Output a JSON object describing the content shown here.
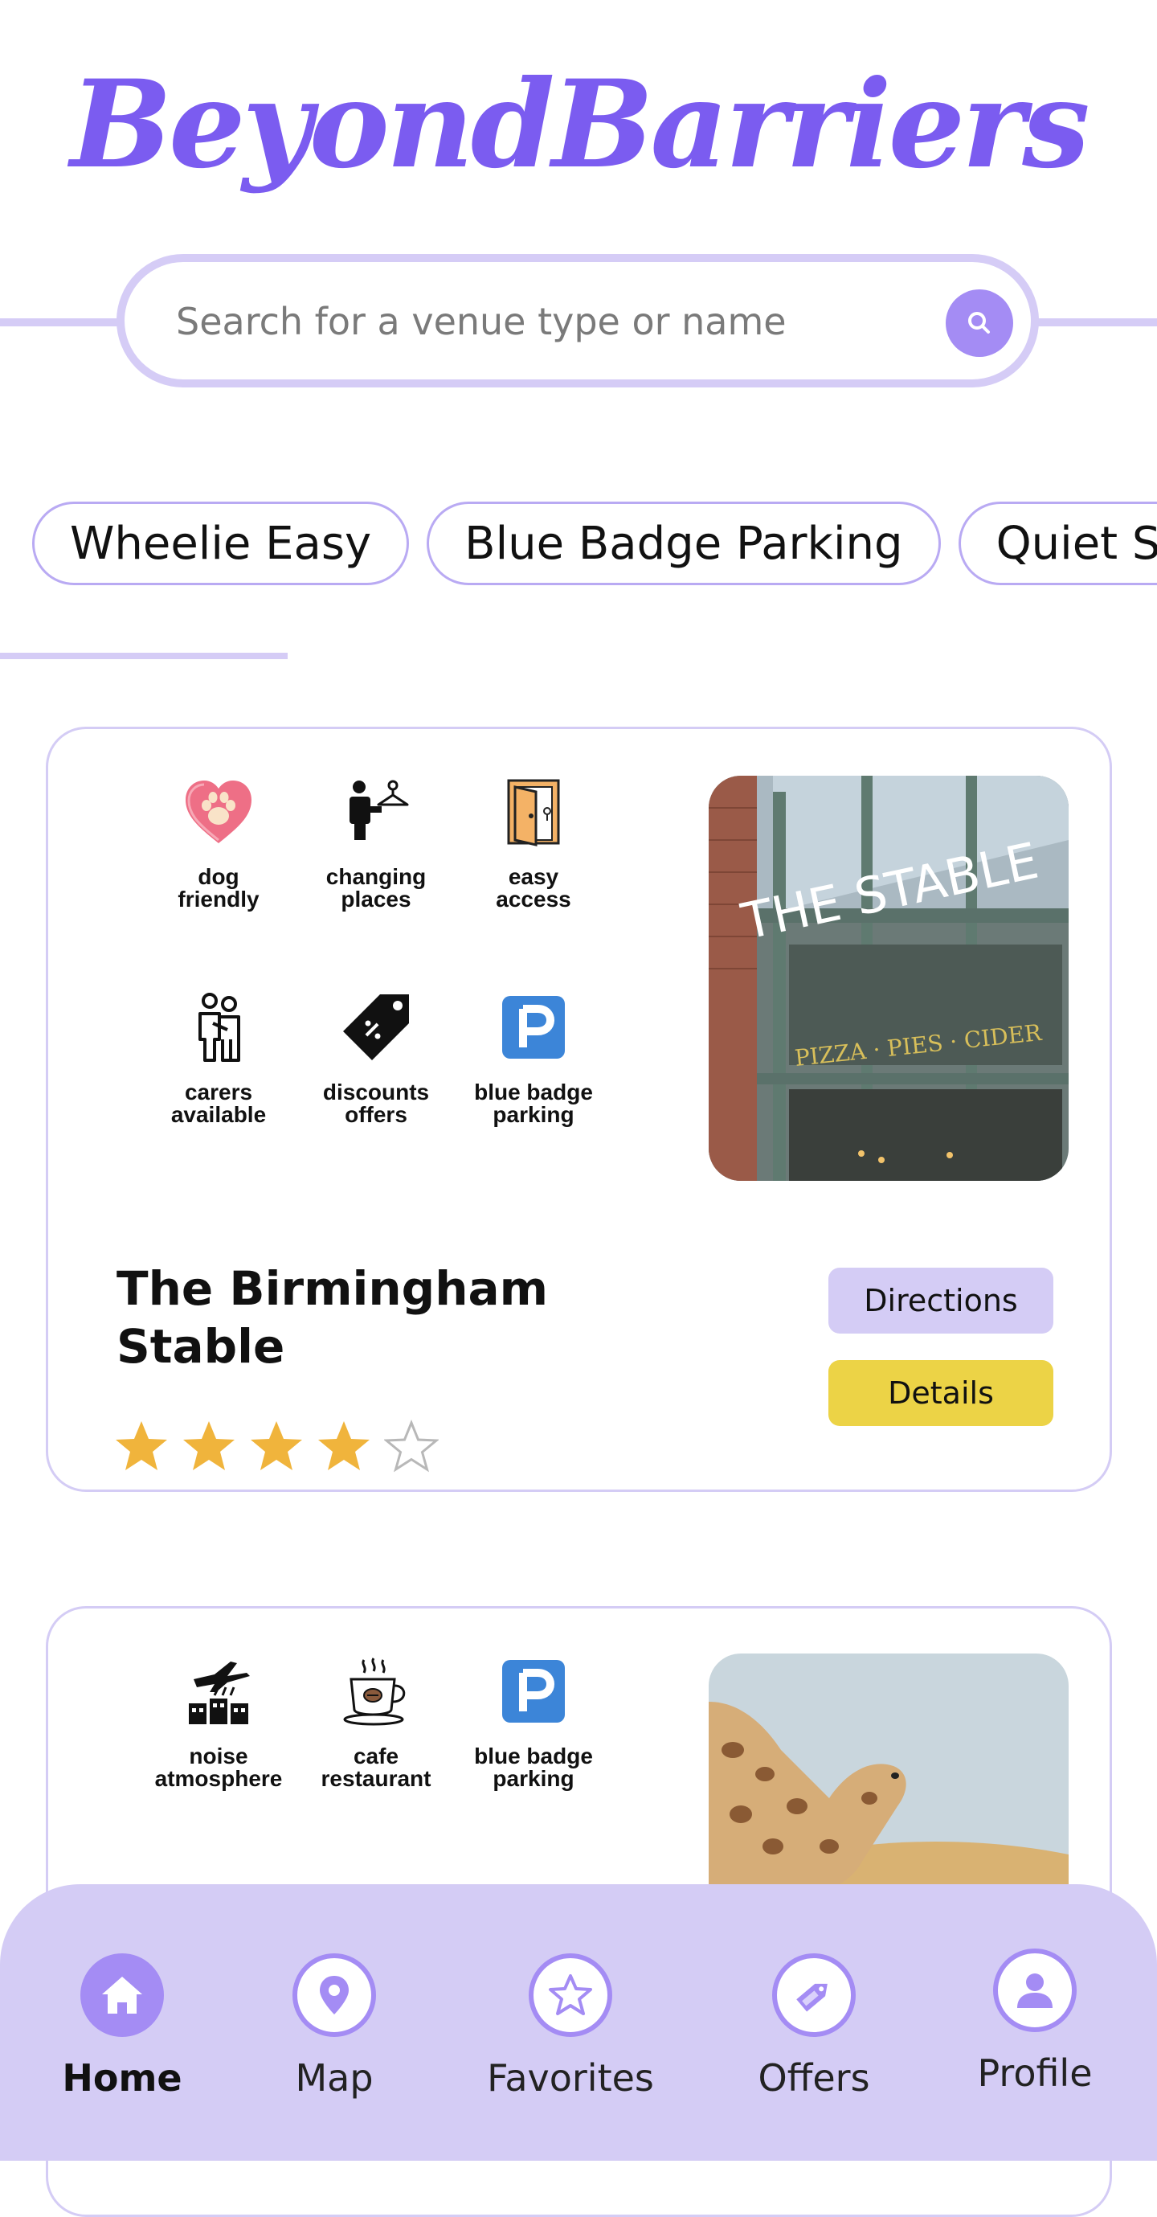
{
  "app": {
    "title": "BeyondBarriers"
  },
  "search": {
    "placeholder": "Search for a venue type or name"
  },
  "filters": [
    "Wheelie Easy",
    "Blue Badge Parking",
    "Quiet S"
  ],
  "venues": [
    {
      "name": "The Birmingham Stable",
      "rating": 4,
      "rating_max": 5,
      "features": [
        {
          "icon": "dog-friendly-icon",
          "line1": "dog",
          "line2": "friendly"
        },
        {
          "icon": "changing-places-icon",
          "line1": "changing",
          "line2": "places"
        },
        {
          "icon": "easy-access-icon",
          "line1": "easy",
          "line2": "access"
        },
        {
          "icon": "carers-available-icon",
          "line1": "carers",
          "line2": "available"
        },
        {
          "icon": "discounts-offers-icon",
          "line1": "discounts",
          "line2": "offers"
        },
        {
          "icon": "blue-badge-parking-icon",
          "line1": "blue badge",
          "line2": "parking"
        }
      ],
      "photo": {
        "sign_text": "THE STABLE",
        "window_text": "PIZZA · PIES · CIDER"
      },
      "directions_label": "Directions",
      "details_label": "Details"
    },
    {
      "features": [
        {
          "icon": "noise-atmosphere-icon",
          "line1": "noise",
          "line2": "atmosphere"
        },
        {
          "icon": "cafe-restaurant-icon",
          "line1": "cafe",
          "line2": "restaurant"
        },
        {
          "icon": "blue-badge-parking-icon",
          "line1": "blue badge",
          "line2": "parking"
        }
      ]
    }
  ],
  "nav": {
    "active": "Home",
    "items": [
      {
        "label": "Home",
        "icon": "home-icon"
      },
      {
        "label": "Map",
        "icon": "map-pin-icon"
      },
      {
        "label": "Favorites",
        "icon": "star-icon"
      },
      {
        "label": "Offers",
        "icon": "deal-tag-icon"
      },
      {
        "label": "Profile",
        "icon": "user-icon"
      }
    ]
  },
  "colors": {
    "brand": "#7b5cf0",
    "accent_light": "#d4ccf5",
    "accent_mid": "#a48cf4",
    "details_button": "#ecd346",
    "star": "#f0b43c"
  }
}
